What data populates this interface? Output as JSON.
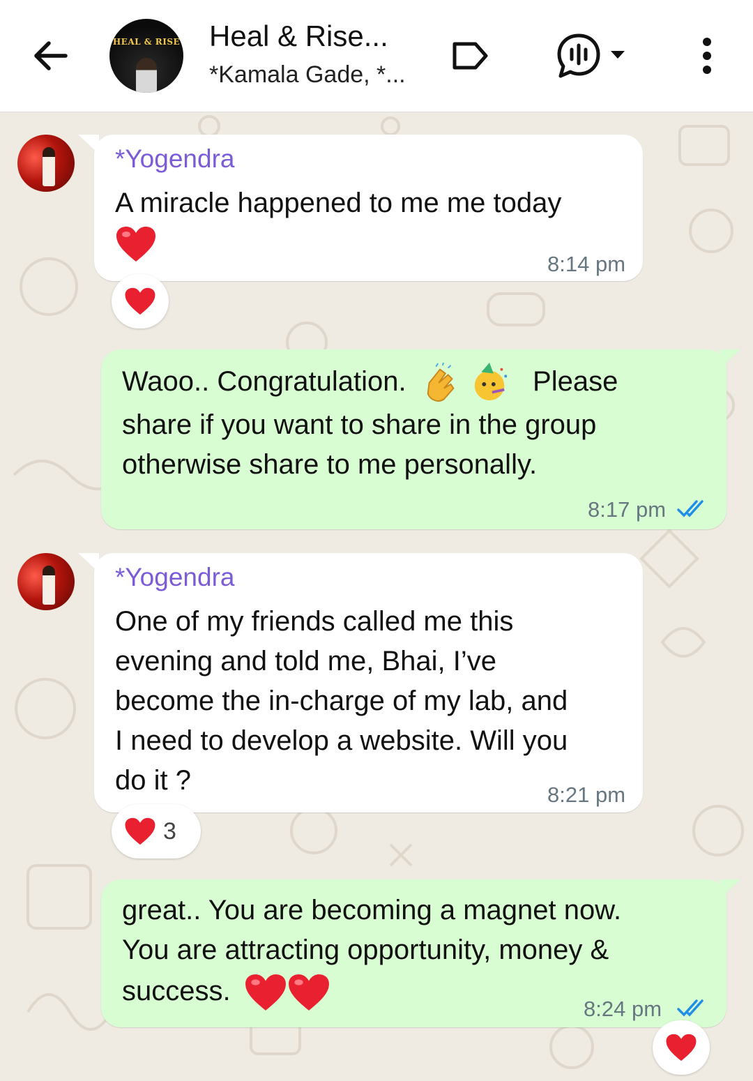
{
  "header": {
    "title": "Heal & Rise...",
    "subtitle": "*Kamala Gade, *...",
    "avatar_text": "HEAL & RISE"
  },
  "messages": [
    {
      "direction": "incoming",
      "sender": "*Yogendra",
      "text": "A miracle happened to me me today",
      "time": "8:14 pm",
      "reaction": {
        "emoji": "heart",
        "count": ""
      }
    },
    {
      "direction": "outgoing",
      "line1": "Waoo.. Congratulation.",
      "line1_after": "Please",
      "line2": "share if you want to share in the group",
      "line3": "otherwise share to me personally.",
      "time": "8:17 pm",
      "status": "read"
    },
    {
      "direction": "incoming",
      "sender": "*Yogendra",
      "lines": [
        "One of my friends called me this",
        "evening and told me, Bhai, I’ve",
        "become the in-charge of my lab, and",
        "I need to develop a website. Will you",
        "do it ?"
      ],
      "time": "8:21 pm",
      "reaction": {
        "emoji": "heart",
        "count": "3"
      }
    },
    {
      "direction": "outgoing",
      "lines": [
        "great.. You are becoming a magnet now.",
        "You are attracting opportunity, money &",
        "success."
      ],
      "time": "8:24 pm",
      "status": "read",
      "reaction": {
        "emoji": "heart",
        "count": ""
      }
    }
  ],
  "colors": {
    "header_bg": "#ffffff",
    "chat_bg": "#efeae2",
    "incoming_bubble": "#ffffff",
    "outgoing_bubble": "#d9fdd3",
    "sender_name": "#7b5cd6",
    "read_ticks": "#1f8fe5",
    "time": "#667781"
  },
  "icons": [
    "back-arrow-icon",
    "label-icon",
    "voice-chat-icon",
    "chevron-down-icon",
    "more-vertical-icon",
    "heart-emoji",
    "clapping-hands-emoji",
    "party-face-emoji",
    "double-check-icon"
  ]
}
